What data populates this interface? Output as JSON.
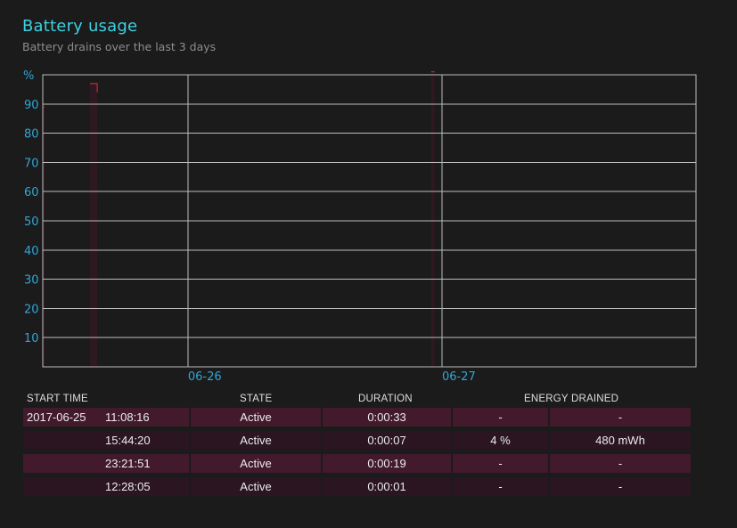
{
  "header": {
    "title": "Battery usage",
    "subtitle": "Battery drains over the last 3 days"
  },
  "chart_data": {
    "type": "area",
    "ylabel": "%",
    "ylim": [
      0,
      100
    ],
    "yticks": [
      10,
      20,
      30,
      40,
      50,
      60,
      70,
      80,
      90
    ],
    "date_labels": [
      "06-26",
      "06-27"
    ],
    "xlim_hours": [
      0,
      72
    ],
    "day_boundaries_hours": [
      16,
      44
    ],
    "series": [
      {
        "start_hour": 0.0,
        "end_hour": 0.2,
        "values": [
          89,
          89
        ]
      },
      {
        "start_hour": 5.2,
        "end_hour": 6.0,
        "values": [
          97,
          94
        ]
      },
      {
        "start_hour": 42.8,
        "end_hour": 43.2,
        "values": [
          101,
          101
        ]
      }
    ],
    "colors": {
      "grid": "#bdbdbd",
      "axis_text": "#2fa6d6",
      "drain_line": "#d9323a",
      "drain_fill": "#2e1822"
    }
  },
  "table": {
    "headers": {
      "start_time": "START TIME",
      "state": "STATE",
      "duration": "DURATION",
      "energy_drained": "ENERGY DRAINED"
    },
    "rows": [
      {
        "date": "2017-06-25",
        "time": "11:08:16",
        "state": "Active",
        "duration": "0:00:33",
        "percent": "-",
        "energy": "-"
      },
      {
        "date": "",
        "time": "15:44:20",
        "state": "Active",
        "duration": "0:00:07",
        "percent": "4 %",
        "energy": "480 mWh"
      },
      {
        "date": "",
        "time": "23:21:51",
        "state": "Active",
        "duration": "0:00:19",
        "percent": "-",
        "energy": "-"
      },
      {
        "date": "",
        "time": "12:28:05",
        "state": "Active",
        "duration": "0:00:01",
        "percent": "-",
        "energy": "-"
      }
    ]
  }
}
